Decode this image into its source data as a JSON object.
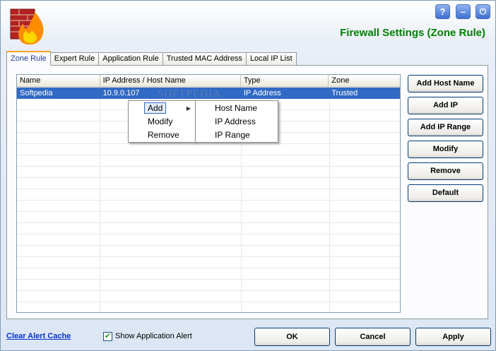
{
  "window": {
    "title": "Firewall Settings (Zone Rule)"
  },
  "titlebar_buttons": [
    {
      "name": "help",
      "glyph": "?"
    },
    {
      "name": "minimize",
      "glyph": "–"
    },
    {
      "name": "power",
      "glyph": "⏻"
    }
  ],
  "tabs": [
    {
      "label": "Zone Rule",
      "active": true
    },
    {
      "label": "Expert Rule",
      "active": false
    },
    {
      "label": "Application Rule",
      "active": false
    },
    {
      "label": "Trusted MAC Address",
      "active": false
    },
    {
      "label": "Local IP List",
      "active": false
    }
  ],
  "table": {
    "columns": [
      "Name",
      "IP Address / Host Name",
      "Type",
      "Zone"
    ],
    "rows": [
      {
        "name": "Softpedia",
        "ip": "10.9.0.107",
        "type": "IP Address",
        "zone": "Trusted",
        "selected": true
      }
    ]
  },
  "watermark": "SOFTPEDIA",
  "context_menu": {
    "items": [
      "Add",
      "Modify",
      "Remove"
    ],
    "submenu": [
      "Host Name",
      "IP Address",
      "IP Range"
    ]
  },
  "side_buttons": [
    "Add Host Name",
    "Add IP",
    "Add IP Range",
    "Modify",
    "Remove",
    "Default"
  ],
  "footer": {
    "clear_cache_link": "Clear Alert Cache",
    "show_alert_label": "Show Application Alert",
    "show_alert_checked": true,
    "ok": "OK",
    "cancel": "Cancel",
    "apply": "Apply"
  },
  "colors": {
    "title": "#008000",
    "selection": "#316ac5",
    "link": "#0033cc"
  }
}
